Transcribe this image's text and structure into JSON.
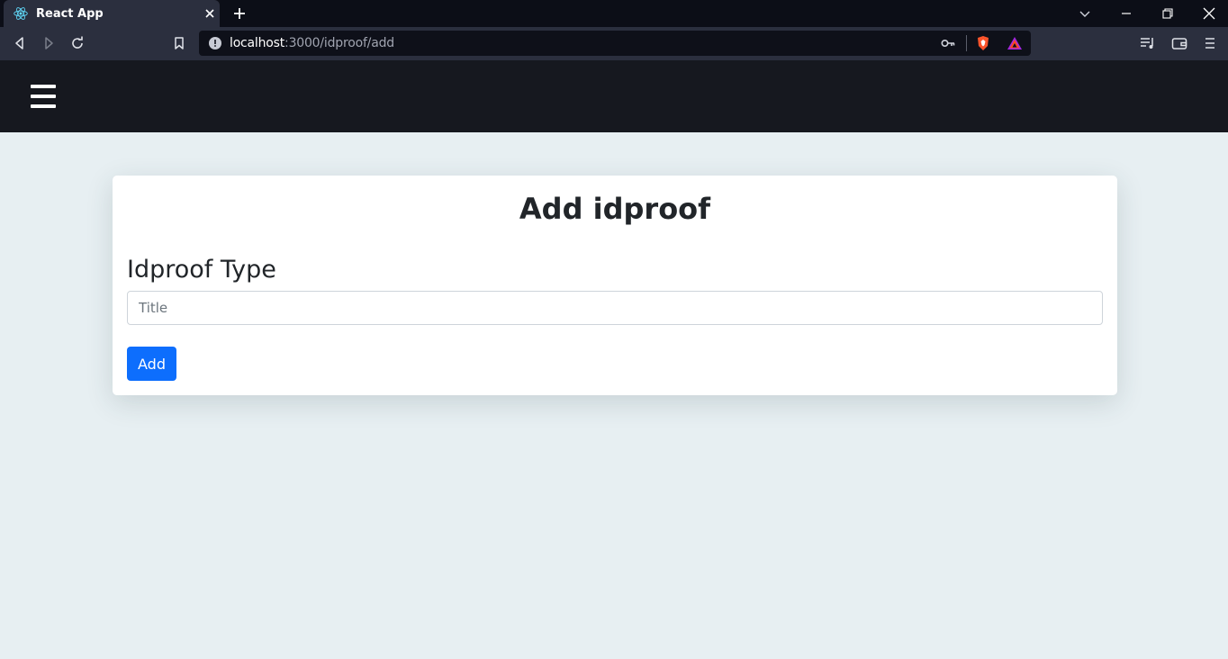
{
  "browser": {
    "tab_title": "React App",
    "url_host": "localhost",
    "url_path": ":3000/idproof/add"
  },
  "icons": {
    "favicon": "react-icon",
    "close": "close-icon",
    "new_tab": "plus-icon",
    "back": "back-icon",
    "forward": "forward-icon",
    "reload": "reload-icon",
    "bookmark": "bookmark-icon",
    "key": "key-icon",
    "brave": "brave-shield-icon",
    "rewards": "brave-rewards-icon",
    "playlist": "playlist-icon",
    "wallet": "wallet-icon",
    "menu": "hamburger-icon"
  },
  "page": {
    "heading": "Add idproof",
    "field_label": "Idproof Type",
    "input_placeholder": "Title",
    "input_value": "",
    "submit_label": "Add"
  },
  "colors": {
    "navbar": "#16181f",
    "background": "#e7eff2",
    "primary": "#0d6efd"
  }
}
